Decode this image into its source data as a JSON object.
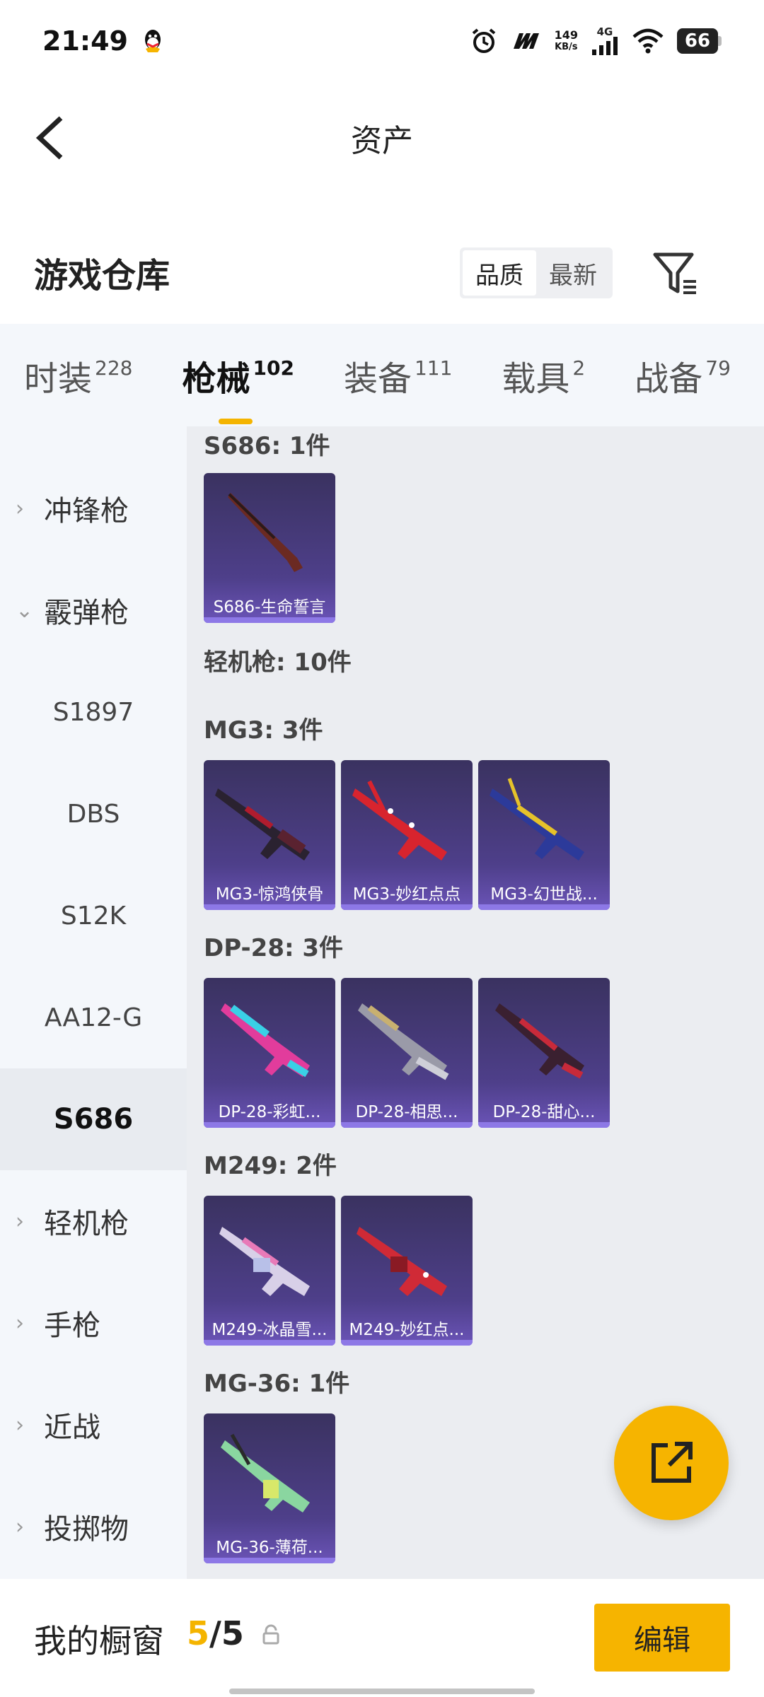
{
  "status_bar": {
    "time": "21:49",
    "net_speed_value": "149",
    "net_speed_unit": "KB/s",
    "network": "4G",
    "battery": "66"
  },
  "header": {
    "title": "资产"
  },
  "warehouse": {
    "title": "游戏仓库",
    "sort_options": [
      "品质",
      "最新"
    ],
    "active_sort": "品质"
  },
  "tabs": [
    {
      "label": "时装",
      "count": "228"
    },
    {
      "label": "枪械",
      "count": "102"
    },
    {
      "label": "装备",
      "count": "111"
    },
    {
      "label": "载具",
      "count": "2"
    },
    {
      "label": "战备",
      "count": "79"
    }
  ],
  "sidebar": {
    "items": [
      {
        "label": "冲锋枪",
        "expanded": false
      },
      {
        "label": "霰弹枪",
        "expanded": true
      },
      {
        "label": "S1897"
      },
      {
        "label": "DBS"
      },
      {
        "label": "S12K"
      },
      {
        "label": "AA12-G"
      },
      {
        "label": "S686",
        "selected": true
      },
      {
        "label": "轻机枪",
        "expanded": false
      },
      {
        "label": "手枪",
        "expanded": false
      },
      {
        "label": "近战",
        "expanded": false
      },
      {
        "label": "投掷物",
        "expanded": false
      }
    ]
  },
  "content": {
    "sections": [
      {
        "label": "S686: 1件",
        "items": [
          "S686-生命誓言"
        ]
      },
      {
        "label": "轻机枪: 10件",
        "items": []
      },
      {
        "label": "MG3: 3件",
        "items": [
          "MG3-惊鸿侠骨",
          "MG3-妙红点点",
          "MG3-幻世战..."
        ]
      },
      {
        "label": "DP-28: 3件",
        "items": [
          "DP-28-彩虹...",
          "DP-28-相思...",
          "DP-28-甜心..."
        ]
      },
      {
        "label": "M249: 2件",
        "items": [
          "M249-冰晶雪...",
          "M249-妙红点..."
        ]
      },
      {
        "label": "MG-36: 1件",
        "items": [
          "MG-36-薄荷..."
        ]
      }
    ]
  },
  "bottom_bar": {
    "label": "我的橱窗",
    "current": "5",
    "separator": "/",
    "total": "5",
    "edit_label": "编辑"
  },
  "colors": {
    "accent": "#f6b400",
    "card_bg": "#4e3f8a",
    "sidebar_bg": "#f4f7fb",
    "content_bg": "#ebedf1"
  }
}
